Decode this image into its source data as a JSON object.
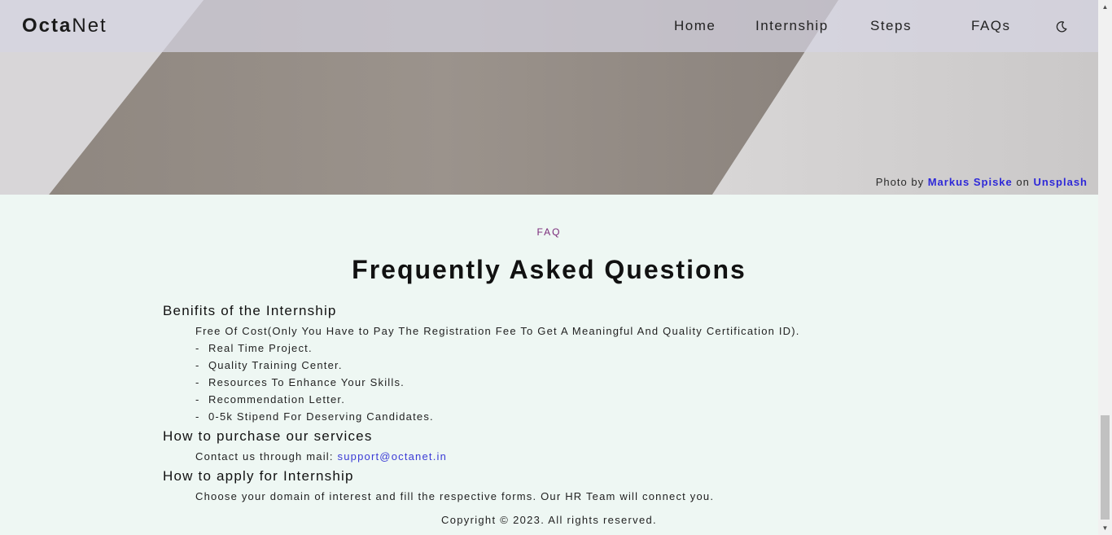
{
  "navbar": {
    "logo_bold": "Octa",
    "logo_light": "Net",
    "links": [
      "Home",
      "Internship",
      "Steps",
      "FAQs"
    ],
    "theme_icon": "moon-icon"
  },
  "hero": {
    "credit_prefix": "Photo by",
    "credit_author": "Markus Spiske",
    "credit_mid": "on",
    "credit_site": "Unsplash"
  },
  "faq": {
    "eyebrow": "FAQ",
    "title": "Frequently Asked Questions",
    "q1": {
      "heading": "Benifits of the Internship",
      "intro": "Free Of Cost(Only You Have to Pay The Registration Fee To Get A Meaningful And Quality Certification ID).",
      "items": [
        "Real Time Project.",
        "Quality Training Center.",
        "Resources To Enhance Your Skills.",
        "Recommendation Letter.",
        "0-5k Stipend For Deserving Candidates."
      ]
    },
    "q2": {
      "heading": "How to purchase our services",
      "text": "Contact us through mail:",
      "email": "support@octanet.in"
    },
    "q3": {
      "heading": "How to apply for Internship",
      "text": "Choose your domain of interest and fill the respective forms. Our HR Team will connect you."
    }
  },
  "footer": {
    "copyright": "Copyright © 2023. All rights reserved."
  },
  "colors": {
    "background": "#eef7f3",
    "accent_link": "#2e28d8",
    "eyebrow": "#7a2a7a",
    "navbar": "#d6d4e2"
  }
}
